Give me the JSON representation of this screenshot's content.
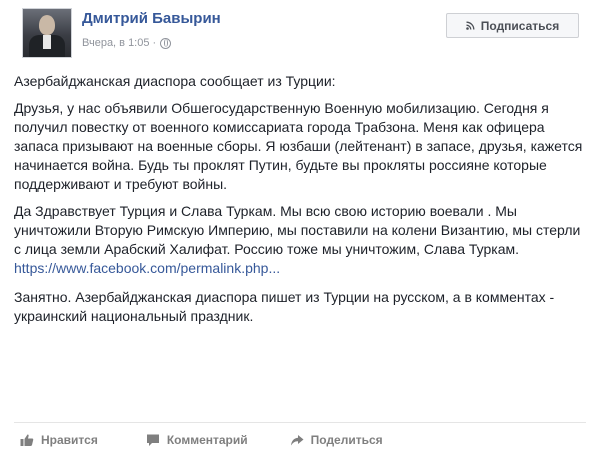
{
  "post": {
    "author": "Дмитрий Бавырин",
    "timestamp": "Вчера, в 1:05 ·",
    "privacy_icon": "globe-icon",
    "follow_label": "Подписаться",
    "follow_icon": "rss-icon",
    "paragraphs": {
      "intro": "Азербайджанская диаспора сообщает из Турции:",
      "p1": "Друзья, у нас объявили Обшегосударственную Военную мобилизацию. Сегодня я получил повестку от военного комиссариата города Трабзона. Меня как офицера запаса призывают на военные сборы. Я юзбаши (лейтенант) в запасе, друзья, кажется начинается война. Будь ты проклят Путин, будьте вы прокляты россияне которые поддерживают и требуют войны.",
      "p2": "Да Здравствует Турция и Слава Туркам. Мы всю свою историю воевали . Мы уничтожили Вторую Римскую Империю, мы поставили на колени Византию, мы стерли с лица земли Арабский Халифат. Россию тоже мы уничтожим, Слава Туркам.",
      "link": "https://www.facebook.com/permalink.php...",
      "p3": "Занятно. Азербайджанская диаспора пишет из Турции на русском, а в комментах - украинский национальный праздник."
    },
    "actions": {
      "like": "Нравится",
      "comment": "Комментарий",
      "share": "Поделиться"
    },
    "colors": {
      "author": "#365899",
      "link": "#365899",
      "meta": "#90949c",
      "actions": "#7f7f7f"
    }
  }
}
